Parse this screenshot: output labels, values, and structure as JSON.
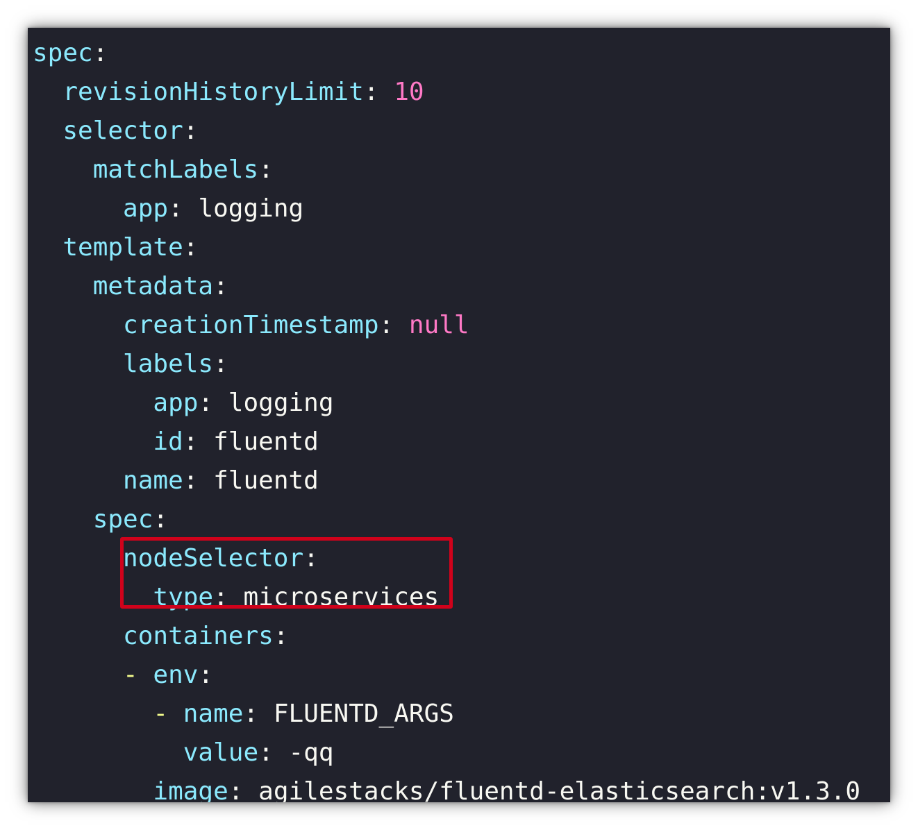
{
  "code_lines": [
    {
      "indent": "",
      "dash": "",
      "key": "spec",
      "value": "",
      "value_type": ""
    },
    {
      "indent": "  ",
      "dash": "",
      "key": "revisionHistoryLimit",
      "value": "10",
      "value_type": "num"
    },
    {
      "indent": "  ",
      "dash": "",
      "key": "selector",
      "value": "",
      "value_type": ""
    },
    {
      "indent": "    ",
      "dash": "",
      "key": "matchLabels",
      "value": "",
      "value_type": ""
    },
    {
      "indent": "      ",
      "dash": "",
      "key": "app",
      "value": "logging",
      "value_type": "str"
    },
    {
      "indent": "  ",
      "dash": "",
      "key": "template",
      "value": "",
      "value_type": ""
    },
    {
      "indent": "    ",
      "dash": "",
      "key": "metadata",
      "value": "",
      "value_type": ""
    },
    {
      "indent": "      ",
      "dash": "",
      "key": "creationTimestamp",
      "value": "null",
      "value_type": "nul"
    },
    {
      "indent": "      ",
      "dash": "",
      "key": "labels",
      "value": "",
      "value_type": ""
    },
    {
      "indent": "        ",
      "dash": "",
      "key": "app",
      "value": "logging",
      "value_type": "str"
    },
    {
      "indent": "        ",
      "dash": "",
      "key": "id",
      "value": "fluentd",
      "value_type": "str"
    },
    {
      "indent": "      ",
      "dash": "",
      "key": "name",
      "value": "fluentd",
      "value_type": "str"
    },
    {
      "indent": "    ",
      "dash": "",
      "key": "spec",
      "value": "",
      "value_type": ""
    },
    {
      "indent": "      ",
      "dash": "",
      "key": "nodeSelector",
      "value": "",
      "value_type": ""
    },
    {
      "indent": "        ",
      "dash": "",
      "key": "type",
      "value": "microservices",
      "value_type": "str"
    },
    {
      "indent": "      ",
      "dash": "",
      "key": "containers",
      "value": "",
      "value_type": ""
    },
    {
      "indent": "      ",
      "dash": "- ",
      "key": "env",
      "value": "",
      "value_type": ""
    },
    {
      "indent": "        ",
      "dash": "- ",
      "key": "name",
      "value": "FLUENTD_ARGS",
      "value_type": "str"
    },
    {
      "indent": "          ",
      "dash": "",
      "key": "value",
      "value": "-qq",
      "value_type": "str"
    },
    {
      "indent": "        ",
      "dash": "",
      "key": "image",
      "value": "agilestacks/fluentd-elasticsearch:v1.3.0",
      "value_type": "str"
    }
  ],
  "colors": {
    "background": "#21222c",
    "key": "#8be9fd",
    "number_null": "#ff79c6",
    "string": "#f8f8f2",
    "dash": "#f1fa8c",
    "highlight_border": "#d0021b"
  }
}
